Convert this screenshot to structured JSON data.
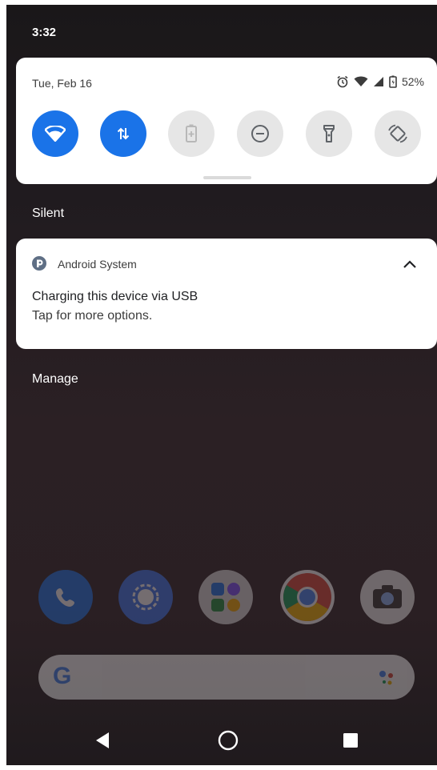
{
  "status_bar": {
    "time": "3:32"
  },
  "quick_settings": {
    "date": "Tue, Feb 16",
    "battery_percent": "52%",
    "tiles": [
      {
        "name": "wifi-tile",
        "icon": "wifi-icon",
        "active": true
      },
      {
        "name": "mobile-data-tile",
        "icon": "data-arrows-icon",
        "active": true
      },
      {
        "name": "battery-saver-tile",
        "icon": "battery-saver-icon",
        "active": false
      },
      {
        "name": "do-not-disturb-tile",
        "icon": "do-not-disturb-icon",
        "active": false
      },
      {
        "name": "flashlight-tile",
        "icon": "flashlight-icon",
        "active": false
      },
      {
        "name": "auto-rotate-tile",
        "icon": "auto-rotate-icon",
        "active": false
      }
    ]
  },
  "sections": {
    "silent": "Silent",
    "manage": "Manage"
  },
  "notification": {
    "app_name": "Android System",
    "title": "Charging this device via USB",
    "text": "Tap for more options."
  },
  "colors": {
    "active_tile": "#1a73e8",
    "inactive_tile": "#e6e6e6"
  }
}
